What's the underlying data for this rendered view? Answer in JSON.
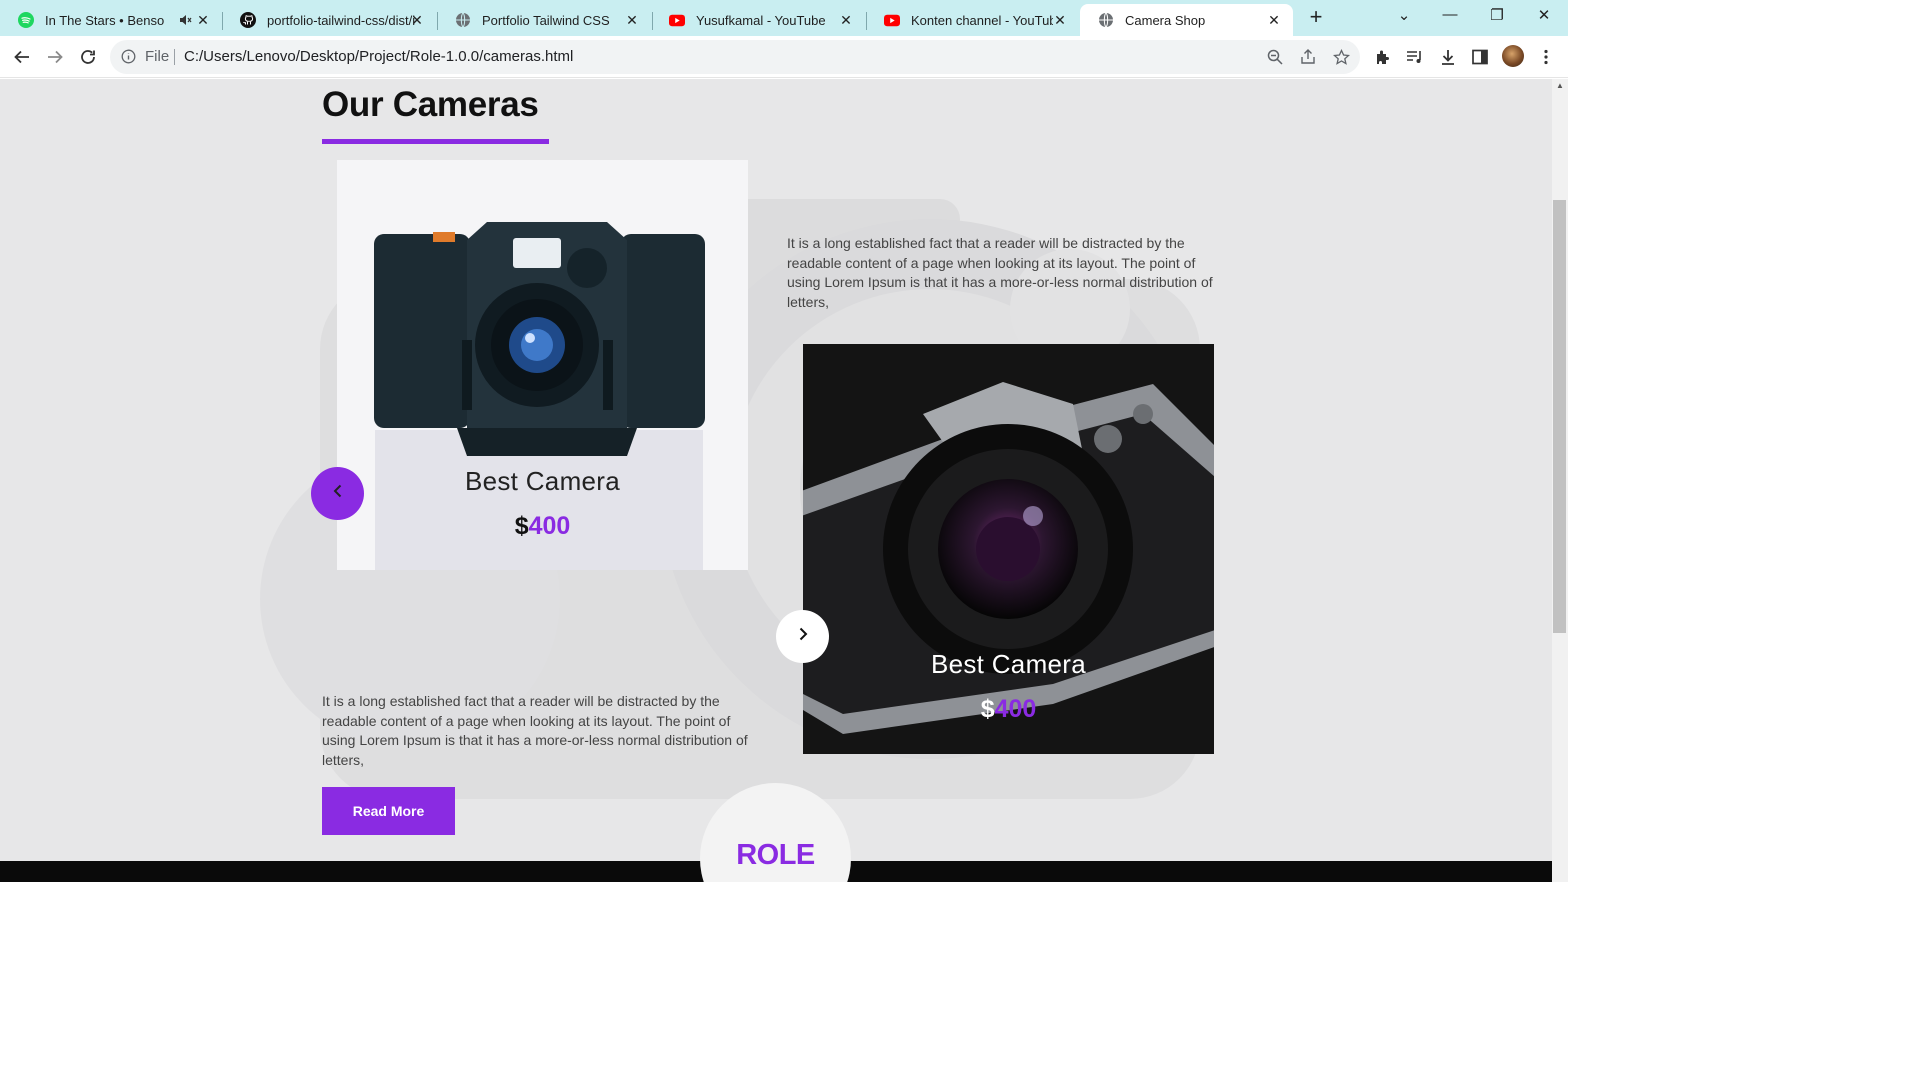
{
  "browser": {
    "tabs": [
      {
        "title": "In The Stars • Benson Boone",
        "icon": "spotify-icon"
      },
      {
        "title": "portfolio-tailwind-css/dist/i",
        "icon": "github-icon"
      },
      {
        "title": "Portfolio Tailwind CSS",
        "icon": "globe-icon"
      },
      {
        "title": "Yusufkamal - YouTube",
        "icon": "youtube-icon"
      },
      {
        "title": "Konten channel - YouTube",
        "icon": "youtube-icon"
      },
      {
        "title": "Camera Shop",
        "icon": "globe-icon"
      }
    ],
    "active_tab": 5,
    "address": {
      "scheme_label": "File",
      "url": "C:/Users/Lenovo/Desktop/Project/Role-1.0.0/cameras.html"
    }
  },
  "page": {
    "heading": "Our Cameras",
    "cards": [
      {
        "title": "Best Camera",
        "currency": "$",
        "price": "400"
      },
      {
        "title": "Best Camera",
        "currency": "$",
        "price": "400"
      }
    ],
    "descriptions": [
      "It is a long established fact that a reader will be distracted by the readable content of a page when looking at its layout. The point of using Lorem Ipsum is that it has a more-or-less normal distribution of letters,",
      "It is a long established fact that a reader will be distracted by the readable content of a page when looking at its layout. The point of using Lorem Ipsum is that it has a more-or-less normal distribution of letters,"
    ],
    "read_more": "Read More",
    "brand": "ROLE"
  },
  "colors": {
    "accent": "#8a2be2",
    "tabbar": "#c9eef1",
    "footer": "#0a0a0a"
  }
}
